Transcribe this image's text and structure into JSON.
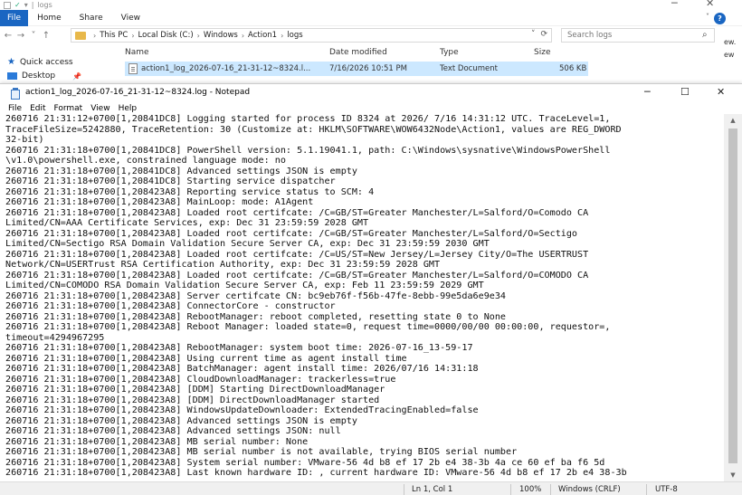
{
  "explorer": {
    "title": "logs",
    "help_label": "?",
    "ribbon_tabs": [
      "File",
      "Home",
      "Share",
      "View"
    ],
    "nav": {
      "back": "←",
      "forward": "→",
      "recent": "˅",
      "up": "↑"
    },
    "breadcrumbs": [
      "This PC",
      "Local Disk (C:)",
      "Windows",
      "Action1",
      "logs"
    ],
    "search_placeholder": "Search logs",
    "sidebar": [
      {
        "label": "Quick access",
        "icon": "star-icon"
      },
      {
        "label": "Desktop",
        "icon": "desktop-icon"
      }
    ],
    "columns": [
      "Name",
      "Date modified",
      "Type",
      "Size"
    ],
    "file_row": {
      "name": "action1_log_2026-07-16_21-31-12~8324.l...",
      "date": "7/16/2026 10:51 PM",
      "type": "Text Document",
      "size": "506 KB"
    },
    "right_cut": [
      "ew.",
      "ew"
    ]
  },
  "notepad": {
    "title": "action1_log_2026-07-16_21-31-12~8324.log - Notepad",
    "menu": [
      "File",
      "Edit",
      "Format",
      "View",
      "Help"
    ],
    "lines": [
      "260716 21:31:12+0700[1,20841DC8] Logging started for process ID 8324 at 2026/ 7/16 14:31:12 UTC. TraceLevel=1,",
      "TraceFileSize=5242880, TraceRetention: 30 (Customize at: HKLM\\SOFTWARE\\WOW6432Node\\Action1, values are REG_DWORD",
      "32-bit)",
      "260716 21:31:18+0700[1,20841DC8] PowerShell version: 5.1.19041.1, path: C:\\Windows\\sysnative\\WindowsPowerShell",
      "\\v1.0\\powershell.exe, constrained language mode: no",
      "260716 21:31:18+0700[1,20841DC8] Advanced settings JSON is empty",
      "260716 21:31:18+0700[1,20841DC8] Starting service dispatcher",
      "260716 21:31:18+0700[1,208423A8] Reporting service status to SCM: 4",
      "260716 21:31:18+0700[1,208423A8] MainLoop: mode: A1Agent",
      "260716 21:31:18+0700[1,208423A8] Loaded root certifcate: /C=GB/ST=Greater Manchester/L=Salford/O=Comodo CA",
      "Limited/CN=AAA Certificate Services, exp: Dec 31 23:59:59 2028 GMT",
      "260716 21:31:18+0700[1,208423A8] Loaded root certifcate: /C=GB/ST=Greater Manchester/L=Salford/O=Sectigo",
      "Limited/CN=Sectigo RSA Domain Validation Secure Server CA, exp: Dec 31 23:59:59 2030 GMT",
      "260716 21:31:18+0700[1,208423A8] Loaded root certifcate: /C=US/ST=New Jersey/L=Jersey City/O=The USERTRUST",
      "Network/CN=USERTrust RSA Certification Authority, exp: Dec 31 23:59:59 2028 GMT",
      "260716 21:31:18+0700[1,208423A8] Loaded root certifcate: /C=GB/ST=Greater Manchester/L=Salford/O=COMODO CA",
      "Limited/CN=COMODO RSA Domain Validation Secure Server CA, exp: Feb 11 23:59:59 2029 GMT",
      "260716 21:31:18+0700[1,208423A8] Server certifcate CN: bc9eb76f-f56b-47fe-8ebb-99e5da6e9e34",
      "260716 21:31:18+0700[1,208423A8] ConnectorCore - constructor",
      "260716 21:31:18+0700[1,208423A8] RebootManager: reboot completed, resetting state 0 to None",
      "260716 21:31:18+0700[1,208423A8] Reboot Manager: loaded state=0, request time=0000/00/00 00:00:00, requestor=,",
      "timeout=4294967295",
      "260716 21:31:18+0700[1,208423A8] RebootManager: system boot time: 2026-07-16_13-59-17",
      "260716 21:31:18+0700[1,208423A8] Using current time as agent install time",
      "260716 21:31:18+0700[1,208423A8] BatchManager: agent install time: 2026/07/16 14:31:18",
      "260716 21:31:18+0700[1,208423A8] CloudDownloadManager: trackerless=true",
      "260716 21:31:18+0700[1,208423A8] [DDM] Starting DirectDownloadManager",
      "260716 21:31:18+0700[1,208423A8] [DDM] DirectDownloadManager started",
      "260716 21:31:18+0700[1,208423A8] WindowsUpdateDownloader: ExtendedTracingEnabled=false",
      "260716 21:31:18+0700[1,208423A8] Advanced settings JSON is empty",
      "260716 21:31:18+0700[1,208423A8] Advanced settings JSON: null",
      "260716 21:31:18+0700[1,208423A8] MB serial number: None",
      "260716 21:31:18+0700[1,208423A8] MB serial number is not available, trying BIOS serial number",
      "260716 21:31:18+0700[1,208423A8] System serial number: VMware-56 4d b8 ef 17 2b e4 38-3b 4a ce 60 ef ba f6 5d",
      "260716 21:31:18+0700[1,208423A8] Last known hardware ID: , current hardware ID: VMware-56 4d b8 ef 17 2b e4 38-3b"
    ],
    "status": {
      "position": "Ln 1, Col 1",
      "zoom": "100%",
      "line_ending": "Windows (CRLF)",
      "encoding": "UTF-8"
    }
  }
}
